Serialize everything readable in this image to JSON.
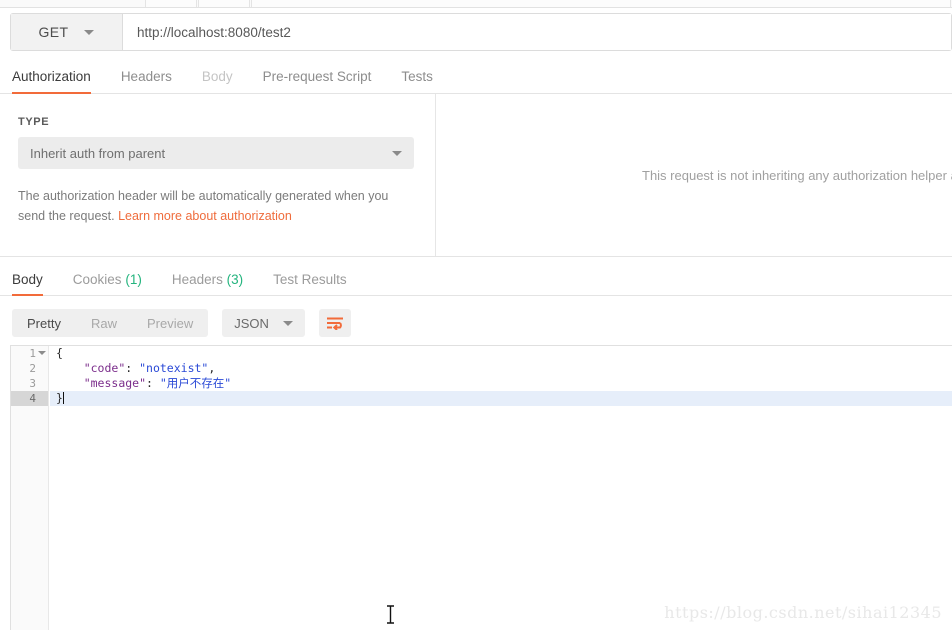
{
  "request": {
    "method": "GET",
    "url": "http://localhost:8080/test2",
    "method_caret": "chevron-down-icon",
    "tabs": [
      {
        "label": "Authorization",
        "state": "active"
      },
      {
        "label": "Headers",
        "state": "normal"
      },
      {
        "label": "Body",
        "state": "dim"
      },
      {
        "label": "Pre-request Script",
        "state": "normal"
      },
      {
        "label": "Tests",
        "state": "normal"
      }
    ]
  },
  "auth": {
    "type_label": "TYPE",
    "selected_type": "Inherit auth from parent",
    "helper_text": "The authorization header will be automatically generated when you send the request. ",
    "helper_link": "Learn more about authorization",
    "right_note": "This request is not inheriting any authorization helper a"
  },
  "response": {
    "tabs": [
      {
        "label": "Body",
        "count": "",
        "state": "active"
      },
      {
        "label": "Cookies",
        "count": "(1)",
        "state": "normal"
      },
      {
        "label": "Headers",
        "count": "(3)",
        "state": "normal"
      },
      {
        "label": "Test Results",
        "count": "",
        "state": "normal"
      }
    ],
    "view_modes": [
      {
        "label": "Pretty",
        "state": "active"
      },
      {
        "label": "Raw",
        "state": "normal"
      },
      {
        "label": "Preview",
        "state": "normal"
      }
    ],
    "format": "JSON",
    "format_caret": "chevron-down-icon",
    "wrap_button": "wrap-lines-icon",
    "body": {
      "lines": [
        {
          "no": "1",
          "fold": true,
          "highlight": false,
          "segments": [
            {
              "t": "{",
              "c": "brace"
            }
          ]
        },
        {
          "no": "2",
          "fold": false,
          "highlight": false,
          "segments": [
            {
              "t": "    ",
              "c": "p"
            },
            {
              "t": "\"code\"",
              "c": "k"
            },
            {
              "t": ": ",
              "c": "p"
            },
            {
              "t": "\"notexist\"",
              "c": "v"
            },
            {
              "t": ",",
              "c": "p"
            }
          ]
        },
        {
          "no": "3",
          "fold": false,
          "highlight": false,
          "segments": [
            {
              "t": "    ",
              "c": "p"
            },
            {
              "t": "\"message\"",
              "c": "k"
            },
            {
              "t": ": ",
              "c": "p"
            },
            {
              "t": "\"用户不存在\"",
              "c": "v"
            }
          ]
        },
        {
          "no": "4",
          "fold": false,
          "highlight": true,
          "segments": [
            {
              "t": "}",
              "c": "brace"
            }
          ]
        }
      ]
    }
  },
  "watermark": "https://blog.csdn.net/sihai12345",
  "colors": {
    "accent": "#f26b3a",
    "link": "#ef6c3c",
    "count_green": "#24b47e",
    "json_key": "#7b2d8b",
    "json_value": "#2a49d6",
    "line_highlight": "#e6eefa"
  }
}
